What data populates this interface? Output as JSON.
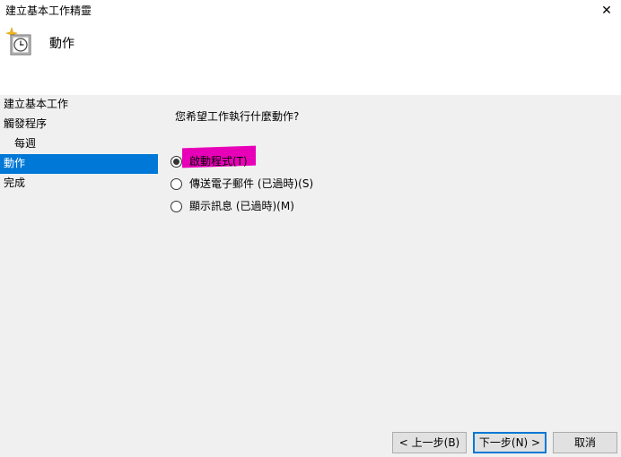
{
  "window": {
    "title": "建立基本工作精靈",
    "close_glyph": "✕"
  },
  "header": {
    "title": "動作",
    "icon": "clock-task-icon"
  },
  "steps": [
    {
      "label": "建立基本工作",
      "sub": false,
      "active": false
    },
    {
      "label": "觸發程序",
      "sub": false,
      "active": false
    },
    {
      "label": "每週",
      "sub": true,
      "active": false
    },
    {
      "label": "動作",
      "sub": false,
      "active": true
    },
    {
      "label": "完成",
      "sub": false,
      "active": false
    }
  ],
  "main": {
    "question": "您希望工作執行什麼動作?",
    "options": [
      {
        "label": "啟動程式(T)",
        "checked": true
      },
      {
        "label": "傳送電子郵件 (已過時)(S)",
        "checked": false
      },
      {
        "label": "顯示訊息 (已過時)(M)",
        "checked": false
      }
    ],
    "highlight_color": "#e800b8"
  },
  "buttons": {
    "back": "< 上一步(B)",
    "next": "下一步(N) >",
    "cancel": "取消"
  },
  "colors": {
    "accent": "#0078d7",
    "panel_bg": "#f0f0f0"
  }
}
